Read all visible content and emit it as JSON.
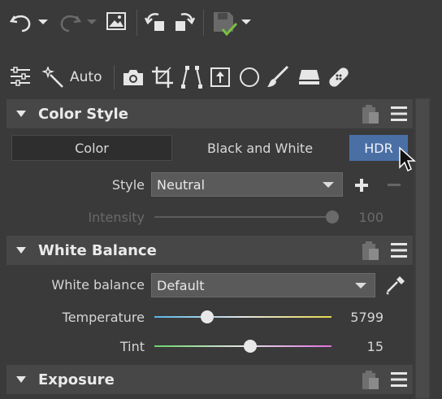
{
  "toolbar": {
    "auto_label": "Auto"
  },
  "color_style": {
    "title": "Color Style",
    "tabs": [
      {
        "label": "Color",
        "state": "selected"
      },
      {
        "label": "Black and White",
        "state": "normal"
      },
      {
        "label": "HDR",
        "state": "hover"
      }
    ],
    "style_label": "Style",
    "style_value": "Neutral",
    "intensity_label": "Intensity",
    "intensity_value": "100",
    "intensity_level": 1.0
  },
  "white_balance": {
    "title": "White Balance",
    "wb_label": "White balance",
    "wb_value": "Default",
    "temperature_label": "Temperature",
    "temperature_value": "5799",
    "tint_label": "Tint",
    "tint_value": "15"
  },
  "exposure": {
    "title": "Exposure"
  },
  "colors": {
    "accent": "#4a6fa5",
    "background": "#3a3a3a",
    "header": "#474747"
  }
}
